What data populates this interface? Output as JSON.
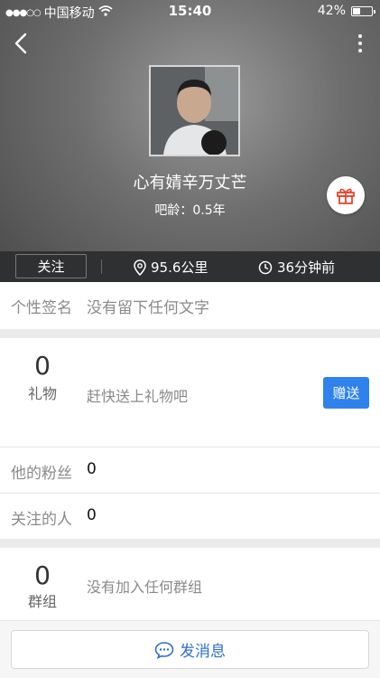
{
  "status_bar": {
    "signal": "●●●○○",
    "carrier": "中国移动",
    "time": "15:40",
    "battery_text": "42%",
    "battery_level": 0.42
  },
  "profile": {
    "nickname": "心有婧辛万丈芒",
    "bar_age": "吧龄：0.5年"
  },
  "info_strip": {
    "follow_label": "关注",
    "distance": "95.6公里",
    "last_seen": "36分钟前"
  },
  "signature": {
    "label": "个性签名",
    "value": "没有留下任何文字"
  },
  "gifts": {
    "count": "0",
    "label": "礼物",
    "hint": "赶快送上礼物吧",
    "send_label": "赠送"
  },
  "fans": {
    "label": "他的粉丝",
    "value": "0"
  },
  "following": {
    "label": "关注的人",
    "value": "0"
  },
  "groups": {
    "count": "0",
    "label": "群组",
    "hint": "没有加入任何群组"
  },
  "bottom": {
    "message_label": "发消息"
  },
  "colors": {
    "accent": "#2f82ec",
    "gift_red": "#e8452c",
    "strip_bg": "#2f3031"
  },
  "icons": [
    "back-icon",
    "more-icon",
    "gift-icon",
    "location-pin-icon",
    "clock-icon",
    "chat-bubble-icon",
    "wifi-icon"
  ]
}
